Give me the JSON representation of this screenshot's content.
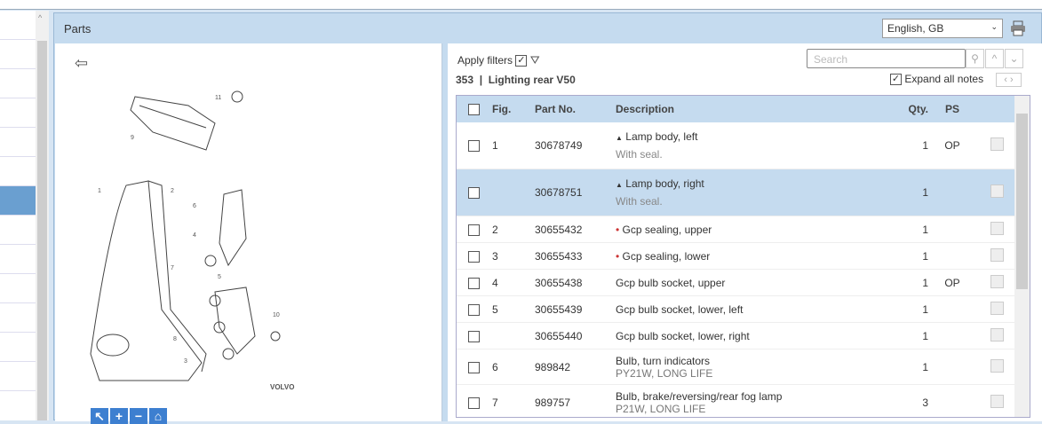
{
  "panel": {
    "title": "Parts",
    "language": "English, GB"
  },
  "filters": {
    "apply_label": "Apply filters",
    "apply_checked": true,
    "search_placeholder": "Search",
    "expand_label": "Expand all notes",
    "expand_checked": true
  },
  "group": {
    "title": "353  |  Lighting rear V50"
  },
  "table": {
    "headers": {
      "fig": "Fig.",
      "part": "Part No.",
      "desc": "Description",
      "qty": "Qty.",
      "ps": "PS"
    },
    "rows": [
      {
        "fig": "1",
        "part": "30678749",
        "desc": "Lamp body, left",
        "note": "With seal.",
        "qty": "1",
        "ps": "OP",
        "marker": "▲"
      },
      {
        "fig": "",
        "part": "30678751",
        "desc": "Lamp body, right",
        "note": "With seal.",
        "qty": "1",
        "ps": "",
        "marker": "▲",
        "selected": true
      },
      {
        "fig": "2",
        "part": "30655432",
        "desc": "Gcp sealing, upper",
        "qty": "1",
        "ps": "",
        "marker": "•"
      },
      {
        "fig": "3",
        "part": "30655433",
        "desc": "Gcp sealing, lower",
        "qty": "1",
        "ps": "",
        "marker": "•"
      },
      {
        "fig": "4",
        "part": "30655438",
        "desc": "Gcp bulb socket, upper",
        "qty": "1",
        "ps": "OP"
      },
      {
        "fig": "5",
        "part": "30655439",
        "desc": "Gcp bulb socket, lower, left",
        "qty": "1",
        "ps": ""
      },
      {
        "fig": "",
        "part": "30655440",
        "desc": "Gcp bulb socket, lower, right",
        "qty": "1",
        "ps": ""
      },
      {
        "fig": "6",
        "part": "989842",
        "desc": "Bulb, turn indicators",
        "note": "PY21W, LONG LIFE",
        "qty": "1",
        "ps": ""
      },
      {
        "fig": "7",
        "part": "989757",
        "desc": "Bulb, brake/reversing/rear fog lamp",
        "note": "P21W, LONG LIFE",
        "qty": "3",
        "ps": ""
      }
    ]
  },
  "diagram": {
    "labels": [
      "1",
      "2",
      "3",
      "4",
      "5",
      "6",
      "7",
      "8",
      "9",
      "10",
      "11"
    ],
    "logo": "VOLVO"
  }
}
